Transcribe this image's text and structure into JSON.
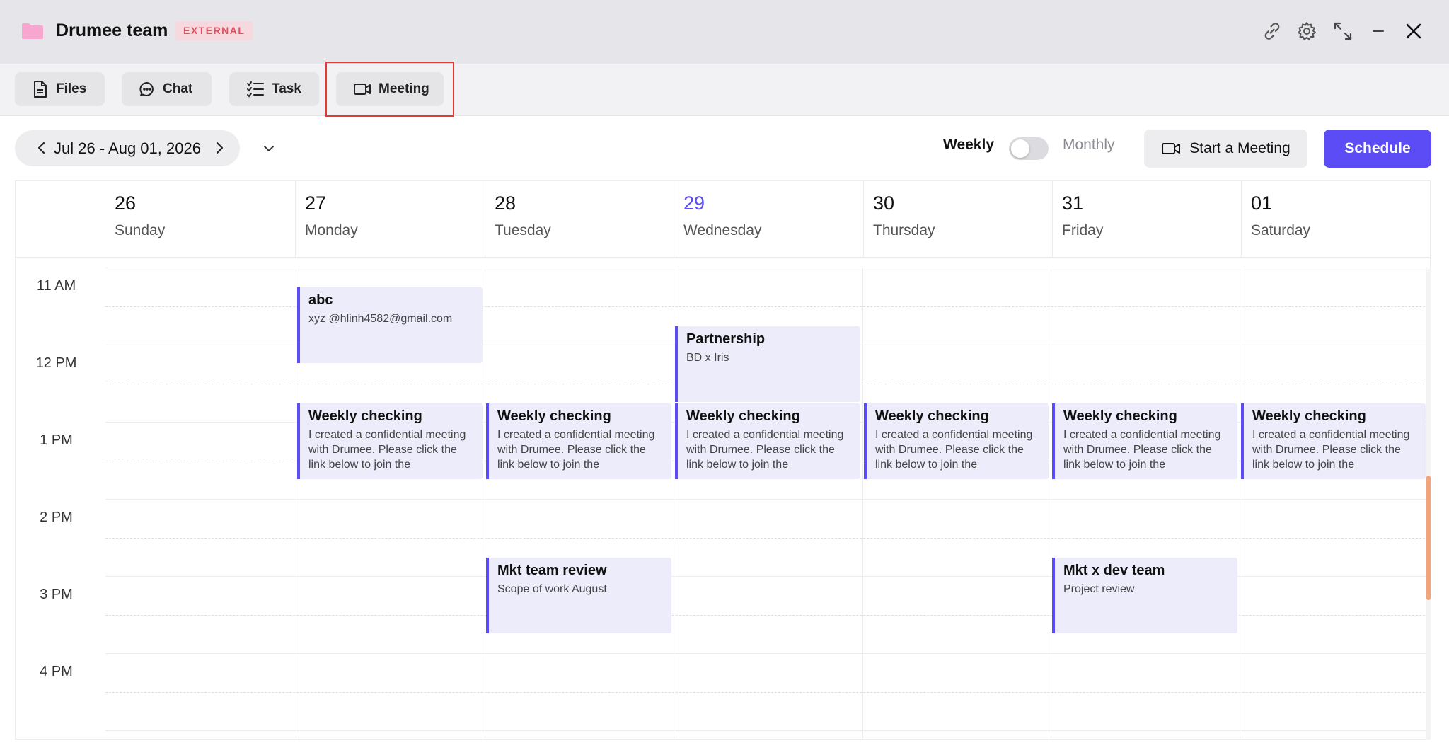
{
  "window": {
    "title": "Drumee team",
    "badge": "EXTERNAL"
  },
  "tabs": [
    {
      "label": "Files",
      "icon": "file-icon"
    },
    {
      "label": "Chat",
      "icon": "chat-icon"
    },
    {
      "label": "Task",
      "icon": "task-list-icon"
    },
    {
      "label": "Meeting",
      "icon": "video-camera-icon",
      "selected": true
    }
  ],
  "toolbar": {
    "date_range": "Jul 26 - Aug 01, 2026",
    "weekly_label": "Weekly",
    "monthly_label": "Monthly",
    "toggle_monthly_on": false,
    "start_meeting_label": "Start a Meeting",
    "schedule_label": "Schedule"
  },
  "days": [
    {
      "num": "26",
      "name": "Sunday"
    },
    {
      "num": "27",
      "name": "Monday"
    },
    {
      "num": "28",
      "name": "Tuesday"
    },
    {
      "num": "29",
      "name": "Wednesday",
      "today": true
    },
    {
      "num": "30",
      "name": "Thursday"
    },
    {
      "num": "31",
      "name": "Friday"
    },
    {
      "num": "01",
      "name": "Saturday"
    }
  ],
  "hours": [
    "11 AM",
    "12 PM",
    "1 PM",
    "2 PM",
    "3 PM",
    "4 PM"
  ],
  "events": [
    {
      "day": 1,
      "start": "11:00",
      "end": "12:00",
      "title": "abc",
      "desc": "xyz @hlinh4582@gmail.com"
    },
    {
      "day": 3,
      "start": "11:30",
      "end": "12:30",
      "title": "Partnership",
      "desc": "BD x Iris"
    },
    {
      "day": 1,
      "start": "12:30",
      "end": "13:30",
      "title": "Weekly checking",
      "desc": "I created a confidential meeting with Drumee. Please click the link below to join the"
    },
    {
      "day": 2,
      "start": "12:30",
      "end": "13:30",
      "title": "Weekly checking",
      "desc": "I created a confidential meeting with Drumee. Please click the link below to join the"
    },
    {
      "day": 3,
      "start": "12:30",
      "end": "13:30",
      "title": "Weekly checking",
      "desc": "I created a confidential meeting with Drumee. Please click the link below to join the"
    },
    {
      "day": 4,
      "start": "12:30",
      "end": "13:30",
      "title": "Weekly checking",
      "desc": "I created a confidential meeting with Drumee. Please click the link below to join the"
    },
    {
      "day": 5,
      "start": "12:30",
      "end": "13:30",
      "title": "Weekly checking",
      "desc": "I created a confidential meeting with Drumee. Please click the link below to join the"
    },
    {
      "day": 6,
      "start": "12:30",
      "end": "13:30",
      "title": "Weekly checking",
      "desc": "I created a confidential meeting with Drumee. Please click the link below to join the"
    },
    {
      "day": 2,
      "start": "14:30",
      "end": "15:30",
      "title": "Mkt team review",
      "desc": "Scope of work August"
    },
    {
      "day": 5,
      "start": "14:30",
      "end": "15:30",
      "title": "Mkt x dev team",
      "desc": "Project review"
    }
  ],
  "colors": {
    "accent": "#5b4cf5",
    "event_bg": "#ececfb",
    "badge_text": "#e0505f",
    "scroll_thumb": "#f2a47a"
  }
}
